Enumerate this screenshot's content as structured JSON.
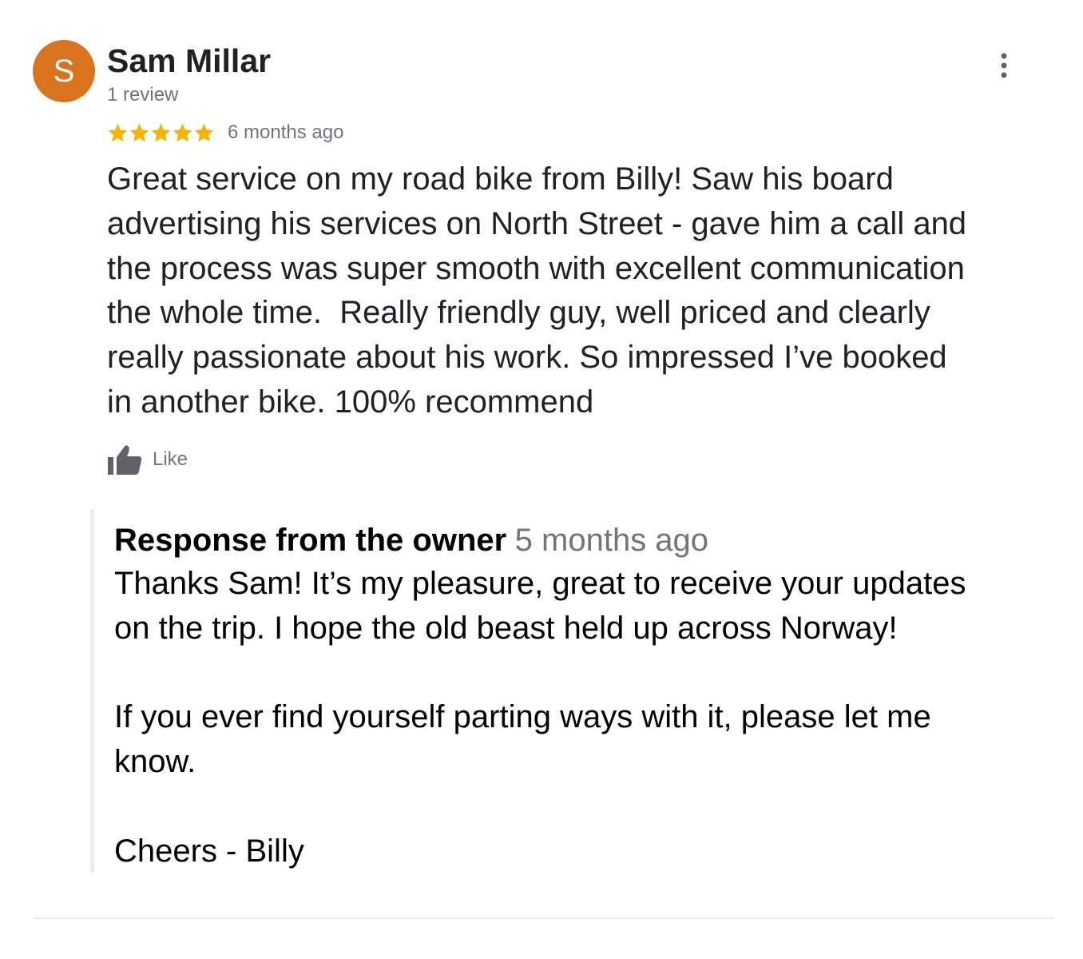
{
  "review": {
    "avatar_letter": "S",
    "avatar_color": "#d9731e",
    "author_name": "Sam Millar",
    "review_count": "1 review",
    "rating": 5,
    "max_rating": 5,
    "star_color": "#f4b400",
    "time_ago": "6 months ago",
    "text": "Great service on my road bike from Billy! Saw his board\nadvertising his services on North Street - gave him a call and\nthe process was super smooth with excellent communication\nthe whole time.  Really friendly guy, well priced and clearly\nreally passionate about his work. So impressed I’ve booked\nin another bike. 100% recommend",
    "like_label": "Like",
    "more_icon": "more-vert-icon"
  },
  "owner_response": {
    "title": "Response from the owner",
    "time_ago": "5 months ago",
    "text": "Thanks Sam! It’s my pleasure, great to receive your updates\non the trip. I hope the old beast held up across Norway!\n\nIf you ever find yourself parting ways with it, please let me\nknow.\n\nCheers - Billy"
  }
}
